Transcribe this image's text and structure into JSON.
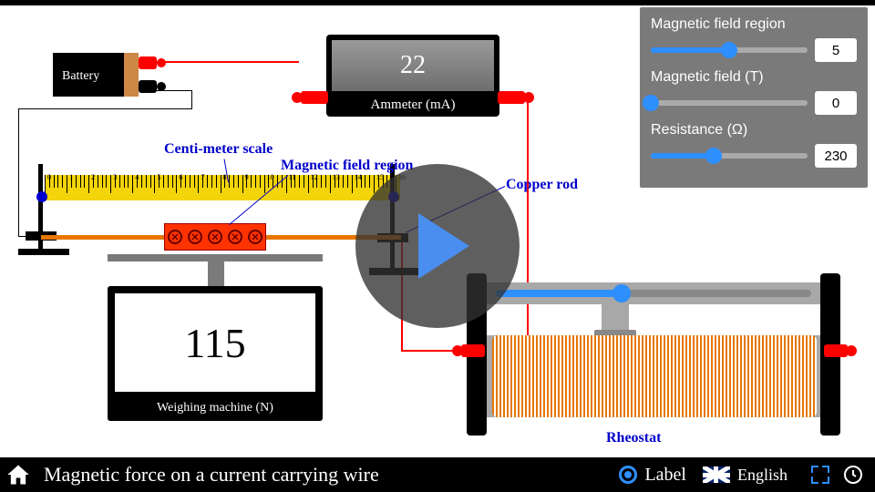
{
  "title": "Magnetic force on a current carrying wire",
  "labels": {
    "centimeter_scale": "Centi-meter scale",
    "magnetic_field_region": "Magnetic field region",
    "copper_rod": "Copper rod",
    "rheostat": "Rheostat",
    "battery": "Battery",
    "ammeter": "Ammeter (mA)",
    "weighing_machine": "Weighing machine (N)"
  },
  "ammeter_value": "22",
  "weighing_value": "115",
  "controls": {
    "magnetic_region": {
      "label": "Magnetic field region",
      "value": "5",
      "pct": 50
    },
    "magnetic_field": {
      "label": "Magnetic field (T)",
      "value": "0",
      "pct": 0
    },
    "resistance": {
      "label": "Resistance (Ω)",
      "value": "230",
      "pct": 40
    }
  },
  "rheostat_slider_pct": 40,
  "toolbar": {
    "label_toggle": "Label",
    "language": "English"
  },
  "ruler_max_cm": 16
}
